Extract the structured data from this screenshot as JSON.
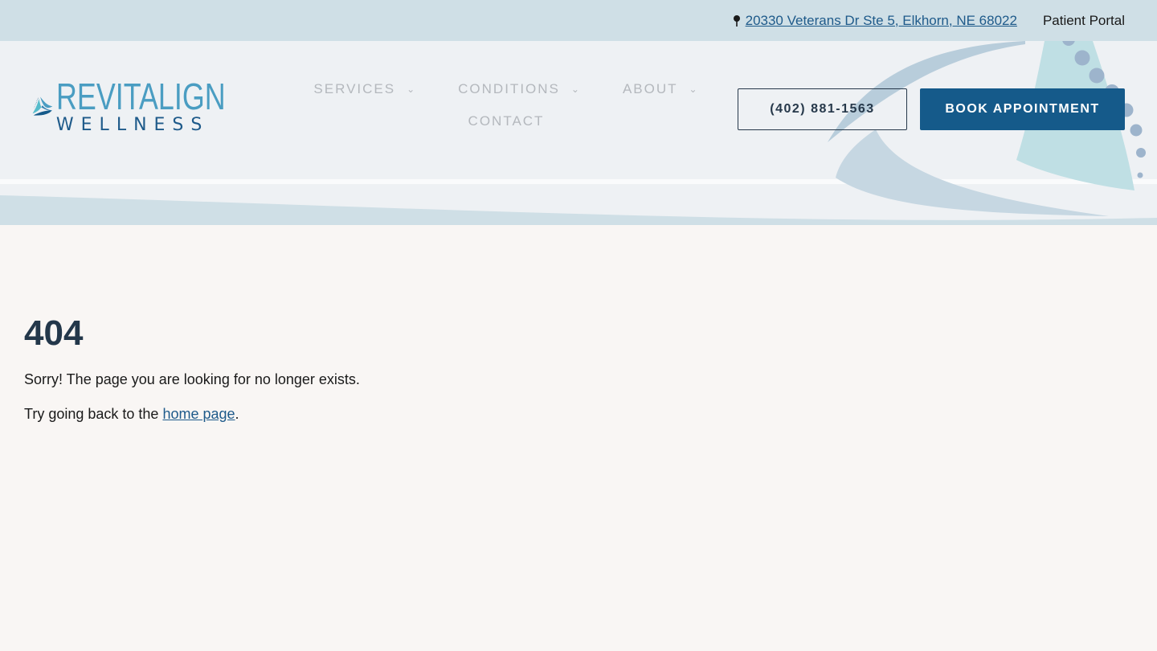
{
  "topbar": {
    "address": "20330 Veterans Dr Ste 5, Elkhorn, NE 68022",
    "address_icon": "map-pin-icon",
    "portal_label": "Patient Portal"
  },
  "logo": {
    "line1": "REVITALIGN",
    "line2": "WELLNESS"
  },
  "nav": {
    "items": [
      {
        "label": "SERVICES",
        "has_dropdown": true
      },
      {
        "label": "CONDITIONS",
        "has_dropdown": true
      },
      {
        "label": "ABOUT",
        "has_dropdown": true
      },
      {
        "label": "CONTACT",
        "has_dropdown": false
      }
    ],
    "chevron": "⌄"
  },
  "header_buttons": {
    "phone_label": "(402) 881-1563",
    "book_label": "BOOK APPOINTMENT"
  },
  "main": {
    "title": "404",
    "message": "Sorry! The page you are looking for no longer exists.",
    "try_prefix": "Try going back to the ",
    "home_link": "home page",
    "try_suffix": "."
  },
  "colors": {
    "topbar_bg": "#cfdfe6",
    "header_bg": "#eef1f4",
    "page_bg": "#f9f6f4",
    "brand_dark": "#155a8a",
    "brand_light": "#4a9dc2",
    "heading": "#23374a"
  }
}
